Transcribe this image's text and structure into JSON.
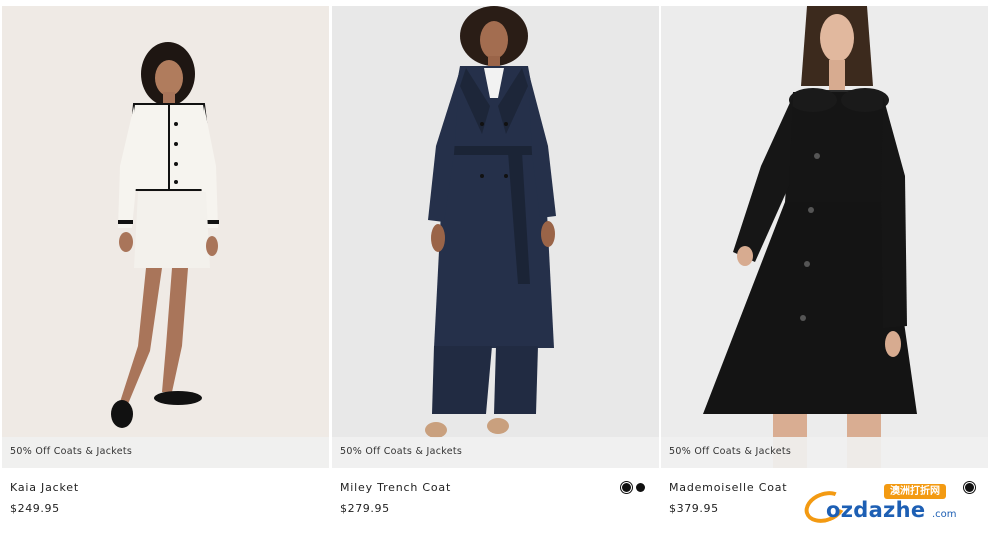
{
  "products": [
    {
      "name": "Kaia Jacket",
      "price": "$249.95",
      "promo": "50% Off Coats & Jackets",
      "image_icon": "model-white-tweed-jacket-skirt",
      "swatches": []
    },
    {
      "name": "Miley Trench Coat",
      "price": "$279.95",
      "promo": "50% Off Coats & Jackets",
      "image_icon": "model-navy-trench-coat",
      "swatches": [
        {
          "color": "#111111",
          "selected": true
        },
        {
          "color": "#111111",
          "selected": false
        }
      ]
    },
    {
      "name": "Mademoiselle Coat",
      "price": "$379.95",
      "promo": "50% Off Coats & Jackets",
      "image_icon": "model-black-flared-coat",
      "swatches": [
        {
          "color": "#111111",
          "selected": true
        }
      ]
    }
  ],
  "watermark": {
    "tag": "澳洲打折网",
    "brand": "ozdazhe",
    "suffix": ".com"
  },
  "colors": {
    "promo_strip": "#f0f0f0",
    "text": "#222222",
    "watermark_orange": "#f39a12",
    "watermark_blue": "#1d5fb4"
  }
}
